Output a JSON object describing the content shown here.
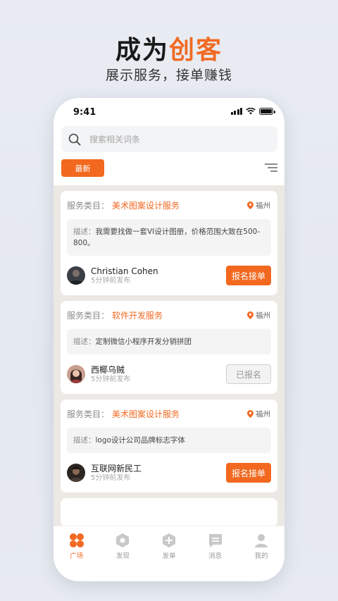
{
  "promo": {
    "title_main": "成为",
    "title_accent": "创客",
    "subtitle": "展示服务，接单赚钱"
  },
  "status_bar": {
    "time": "9:41"
  },
  "search": {
    "placeholder": "搜索相关词条"
  },
  "filter": {
    "latest_label": "最新"
  },
  "cards": [
    {
      "category_label": "服务类目：",
      "category_value": "美术图案设计服务",
      "location": "福州",
      "desc_label": "描述：",
      "desc_text": "我需要找做一套VI设计图册，价格范围大致在500-800。",
      "user_name": "Christian Cohen",
      "posted_time": "5分钟前发布",
      "button_label": "报名接单",
      "button_state": "primary"
    },
    {
      "category_label": "服务类目：",
      "category_value": "软件开发服务",
      "location": "福州",
      "desc_label": "描述：",
      "desc_text": "定制微信小程序开发分销拼团",
      "user_name": "西椰乌贼",
      "posted_time": "5分钟前发布",
      "button_label": "已报名",
      "button_state": "disabled"
    },
    {
      "category_label": "服务类目：",
      "category_value": "美术图案设计服务",
      "location": "福州",
      "desc_label": "描述：",
      "desc_text": "logo设计公司品牌标志字体",
      "user_name": "互联网新民工",
      "posted_time": "5分钟前发布",
      "button_label": "报名接单",
      "button_state": "primary"
    }
  ],
  "tabbar": [
    {
      "label": "广场",
      "icon": "square-grid-icon",
      "active": true
    },
    {
      "label": "发现",
      "icon": "discover-icon",
      "active": false
    },
    {
      "label": "发单",
      "icon": "publish-icon",
      "active": false
    },
    {
      "label": "消息",
      "icon": "message-icon",
      "active": false
    },
    {
      "label": "我的",
      "icon": "profile-icon",
      "active": false
    }
  ],
  "colors": {
    "accent": "#f26a23",
    "feed_bg": "#ece8e4"
  }
}
